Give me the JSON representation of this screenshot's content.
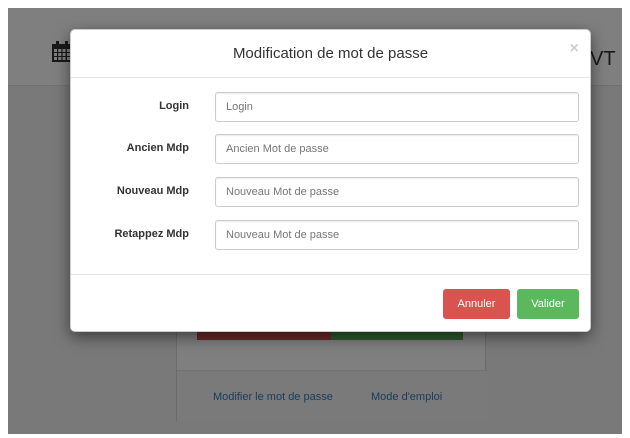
{
  "background": {
    "calendar_icon": "calendar-icon",
    "header_text_fragment": "VT",
    "links": [
      "Modifier le mot de passe",
      "Mode d'emploi"
    ]
  },
  "modal": {
    "title": "Modification de mot de passe",
    "close_symbol": "×",
    "fields": [
      {
        "label": "Login",
        "placeholder": "Login",
        "value": ""
      },
      {
        "label": "Ancien Mdp",
        "placeholder": "Ancien Mot de passe",
        "value": ""
      },
      {
        "label": "Nouveau Mdp",
        "placeholder": "Nouveau Mot de passe",
        "value": ""
      },
      {
        "label": "Retappez Mdp",
        "placeholder": "Nouveau Mot de passe",
        "value": ""
      }
    ],
    "buttons": {
      "cancel": "Annuler",
      "submit": "Valider"
    }
  },
  "colors": {
    "danger": "#d9534f",
    "success": "#5cb85c",
    "link": "#337ab7"
  }
}
